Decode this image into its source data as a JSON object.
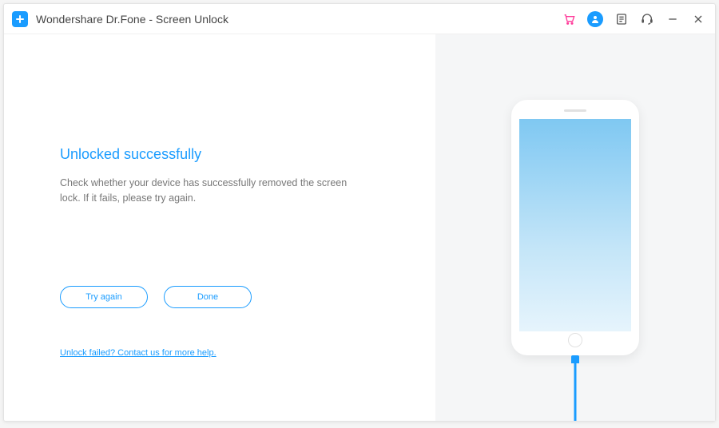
{
  "app": {
    "title": "Wondershare Dr.Fone - Screen Unlock"
  },
  "main": {
    "heading": "Unlocked successfully",
    "description": "Check whether your device has successfully removed the screen lock. If it fails, please try again.",
    "try_again_label": "Try again",
    "done_label": "Done",
    "help_link": "Unlock failed? Contact us for more help."
  }
}
